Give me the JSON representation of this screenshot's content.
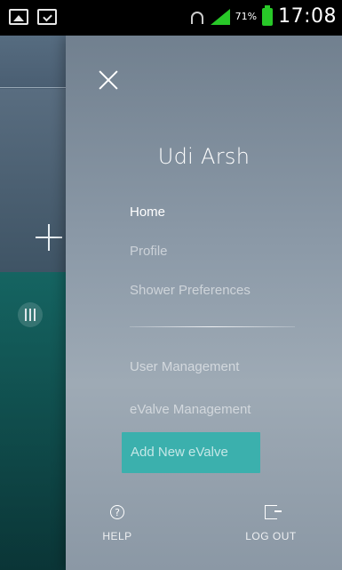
{
  "status_bar": {
    "battery_percent": "71%",
    "time": "17:08",
    "icons": [
      "gallery-icon",
      "clipboard-check-icon",
      "wifi-icon",
      "signal-icon",
      "battery-icon"
    ]
  },
  "drawer": {
    "close_icon": "close-icon",
    "user_name": "Udi Arsh",
    "menu": {
      "home": "Home",
      "profile": "Profile",
      "shower_preferences": "Shower Preferences",
      "user_management": "User Management",
      "evalve_management": "eValve Management"
    },
    "add_evalve": "Add New eValve",
    "footer": {
      "help": "HELP",
      "logout": "LOG OUT"
    }
  },
  "colors": {
    "accent": "#3bb0ad",
    "drawer_top": "#71808f",
    "drawer_mid": "#9eaab5"
  }
}
